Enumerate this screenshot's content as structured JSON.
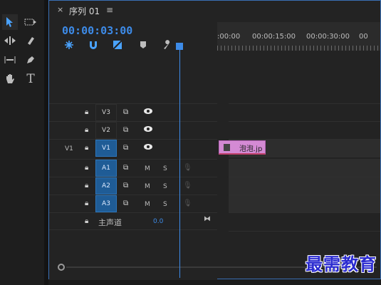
{
  "tab": {
    "close": "×",
    "title": "序列 01",
    "menu": "≡"
  },
  "timecode": "00:00:03:00",
  "ruler": {
    "labels": [
      ":00:00",
      "00:00:15:00",
      "00:00:30:00",
      "00"
    ]
  },
  "tracks": {
    "video": [
      {
        "name": "V3",
        "target": "",
        "eye": "visible"
      },
      {
        "name": "V2",
        "target": "",
        "eye": "visible"
      },
      {
        "name": "V1",
        "target": "V1",
        "eye": "visible"
      }
    ],
    "audio": [
      {
        "name": "A1",
        "m": "M",
        "s": "S"
      },
      {
        "name": "A2",
        "m": "M",
        "s": "S"
      },
      {
        "name": "A3",
        "m": "M",
        "s": "S"
      }
    ],
    "master": {
      "label": "主声道",
      "value": "0.0"
    }
  },
  "clip": {
    "label": "泡泡.jp",
    "color": "#d48ad4"
  },
  "watermark": "最需教育",
  "colors": {
    "accent": "#3d8be8",
    "active_track": "#1f5c96"
  }
}
